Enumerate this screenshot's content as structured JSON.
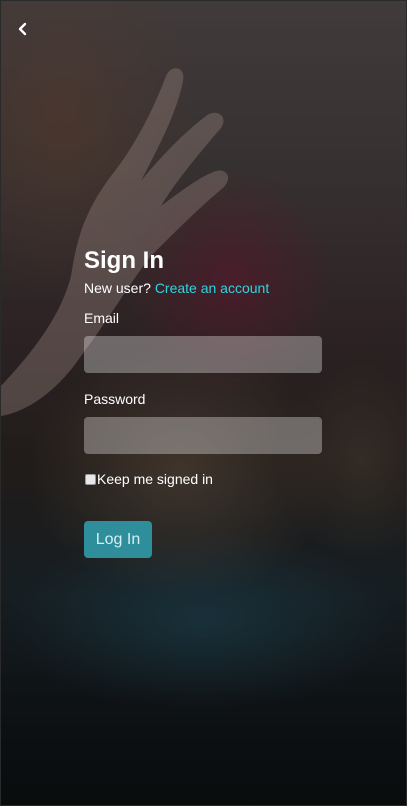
{
  "nav": {
    "back_icon": "chevron-left-icon"
  },
  "form": {
    "title": "Sign In",
    "subtitle_prefix": "New user?",
    "create_account_link": "Create an account",
    "email_label": "Email",
    "email_value": "",
    "password_label": "Password",
    "password_value": "",
    "remember_label": "Keep me signed in",
    "remember_checked": false,
    "login_button": "Log In"
  },
  "colors": {
    "link": "#2fd4e0",
    "button_bg": "#2e8e9c",
    "input_bg": "rgba(255,255,255,0.32)"
  }
}
